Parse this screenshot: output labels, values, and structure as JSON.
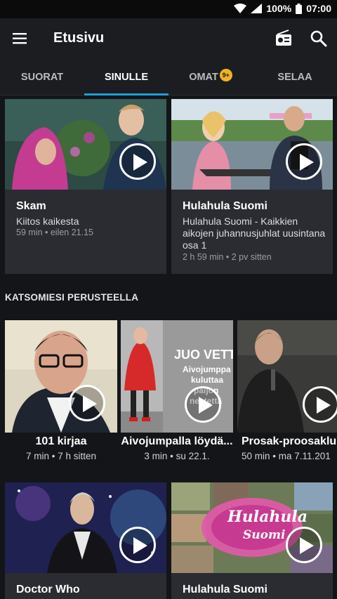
{
  "status": {
    "battery": "100%",
    "time": "07:00"
  },
  "appbar": {
    "title": "Etusivu"
  },
  "tabs": [
    {
      "label": "SUORAT"
    },
    {
      "label": "SINULLE"
    },
    {
      "label": "OMAT",
      "badge": "9+"
    },
    {
      "label": "SELAA"
    }
  ],
  "featured": [
    {
      "title": "Skam",
      "description": "Kiitos kaikesta",
      "meta": "59 min • eilen 21.15"
    },
    {
      "title": "Hulahula Suomi",
      "description": "Hulahula Suomi - Kaikkien aikojen juhannusjuhlat uusintana osa 1",
      "meta": "2 h 59 min • 2 pv sitten"
    }
  ],
  "section": {
    "title": "KATSOMIESI PERUSTEELLA"
  },
  "recommended": [
    {
      "title": "101 kirjaa",
      "meta": "7 min • 7 h sitten"
    },
    {
      "title": "Aivojumpalla löydä...",
      "meta": "3 min • su 22.1.",
      "overlay_lines": [
        "JUO VETT",
        "Aivojumppa",
        "kuluttaa",
        "paljon",
        "nestettä"
      ]
    },
    {
      "title": "Prosak-proosaklu",
      "meta": "50 min • ma 7.11.201"
    }
  ],
  "bottom": [
    {
      "title": "Doctor Who"
    },
    {
      "title": "Hulahula Suomi",
      "logo_text": [
        "Hulahula",
        "Suomi"
      ]
    }
  ],
  "colors": {
    "accent": "#1ba0d8",
    "badge": "#f0b323",
    "card": "#2a2c31",
    "background": "#141518"
  }
}
